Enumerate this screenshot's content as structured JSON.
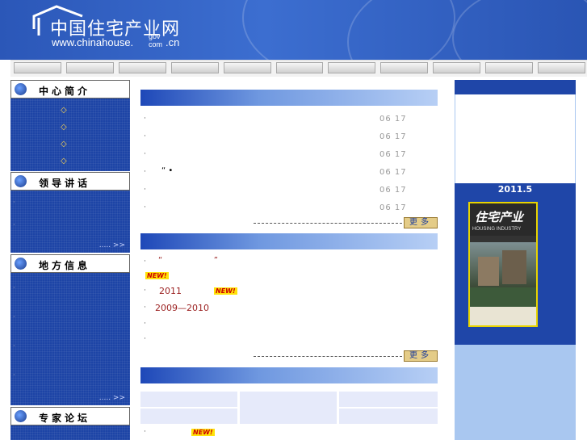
{
  "header": {
    "logo_cn": "中国住宅产业网",
    "logo_en": "www.chinahouse.",
    "logo_gov": "gov",
    "logo_com": "com",
    "logo_suffix": ".cn"
  },
  "nav": {
    "tab_count": 11
  },
  "left": {
    "sections": [
      {
        "title": "中心简介",
        "icon": "globe-icon",
        "items": [
          "◇",
          "◇",
          "◇",
          "◇"
        ]
      },
      {
        "title": "领导讲话",
        "icon": "mail-icon",
        "items": [
          "·",
          "·"
        ],
        "more": "..... >>"
      },
      {
        "title": "地方信息",
        "icon": "globe-icon",
        "items": [
          "·",
          "·",
          "·",
          "·"
        ],
        "more": "..... >>"
      },
      {
        "title": "专家论坛",
        "icon": "people-icon"
      }
    ]
  },
  "center": {
    "news": [
      {
        "bullet": "·",
        "text": "",
        "date": "06 17"
      },
      {
        "bullet": "·",
        "text": "",
        "date": "06 17"
      },
      {
        "bullet": "·",
        "text": "",
        "date": "06 17"
      },
      {
        "bullet": "·",
        "text": "“  •",
        "date": "06 17"
      },
      {
        "bullet": "·",
        "text": "",
        "date": "06 17"
      },
      {
        "bullet": "·",
        "text": "",
        "date": "06 17"
      }
    ],
    "more_label": "更多",
    "list2": [
      {
        "bullet": "·",
        "text": "“                    ”"
      },
      {
        "bullet": "·",
        "text": "2011"
      },
      {
        "bullet": "·",
        "text": "2009—2010"
      },
      {
        "bullet": "·",
        "text": ""
      },
      {
        "bullet": "·",
        "text": ""
      }
    ],
    "new_badge": "NEW!",
    "more_label2": "更多",
    "bottom_bullet": "·"
  },
  "right": {
    "year_label": "2011.5",
    "magazine": {
      "title": "住宅产业",
      "subtitle": "HOUSING INDUSTRY",
      "issue": "05\n2011"
    }
  }
}
